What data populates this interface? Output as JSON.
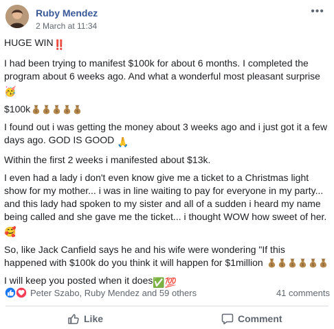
{
  "post": {
    "author": "Ruby Mendez",
    "timestamp": "2 March at 11:34",
    "more_label": "•••",
    "paragraphs": {
      "p1": "HUGE WIN",
      "p2": "I had been trying to manifest $100k for about 6 months. I completed the program about 6 weeks ago. And what a wonderful most pleasant surprise",
      "p3": "$100k",
      "p4": "I found out i was getting the money about 3 weeks ago and i just got it a few days ago. GOD IS GOOD",
      "p5": "Within the first 2 weeks i manifested about $13k.",
      "p6": "I even had a lady i don't even know give me a ticket to a Christmas light show for my mother... i was in line waiting to pay for everyone in my party... and this lady had spoken to my sister and all of a sudden i heard my name being called and she gave me the ticket... i thought WOW how sweet of her.",
      "p7": "So, like Jack Canfield says he and his wife were wondering \"If this happened with $100k do you think it will happen for $1million",
      "p8": "I will keep you posted when it does"
    },
    "emoji": {
      "double_exclamation": "‼️",
      "party_face": "🥳",
      "pray": "🙏",
      "hearts_face": "🥰",
      "check": "✅",
      "hundred": "💯"
    }
  },
  "footer": {
    "reaction_names": "Peter Szabo, Ruby Mendez and 59 others",
    "comments_count": "41 comments",
    "like_label": "Like",
    "comment_label": "Comment"
  },
  "colors": {
    "author": "#385898",
    "like_blue": "#1877f2",
    "love_red": "#f33e58",
    "bag": "#b5894d"
  }
}
